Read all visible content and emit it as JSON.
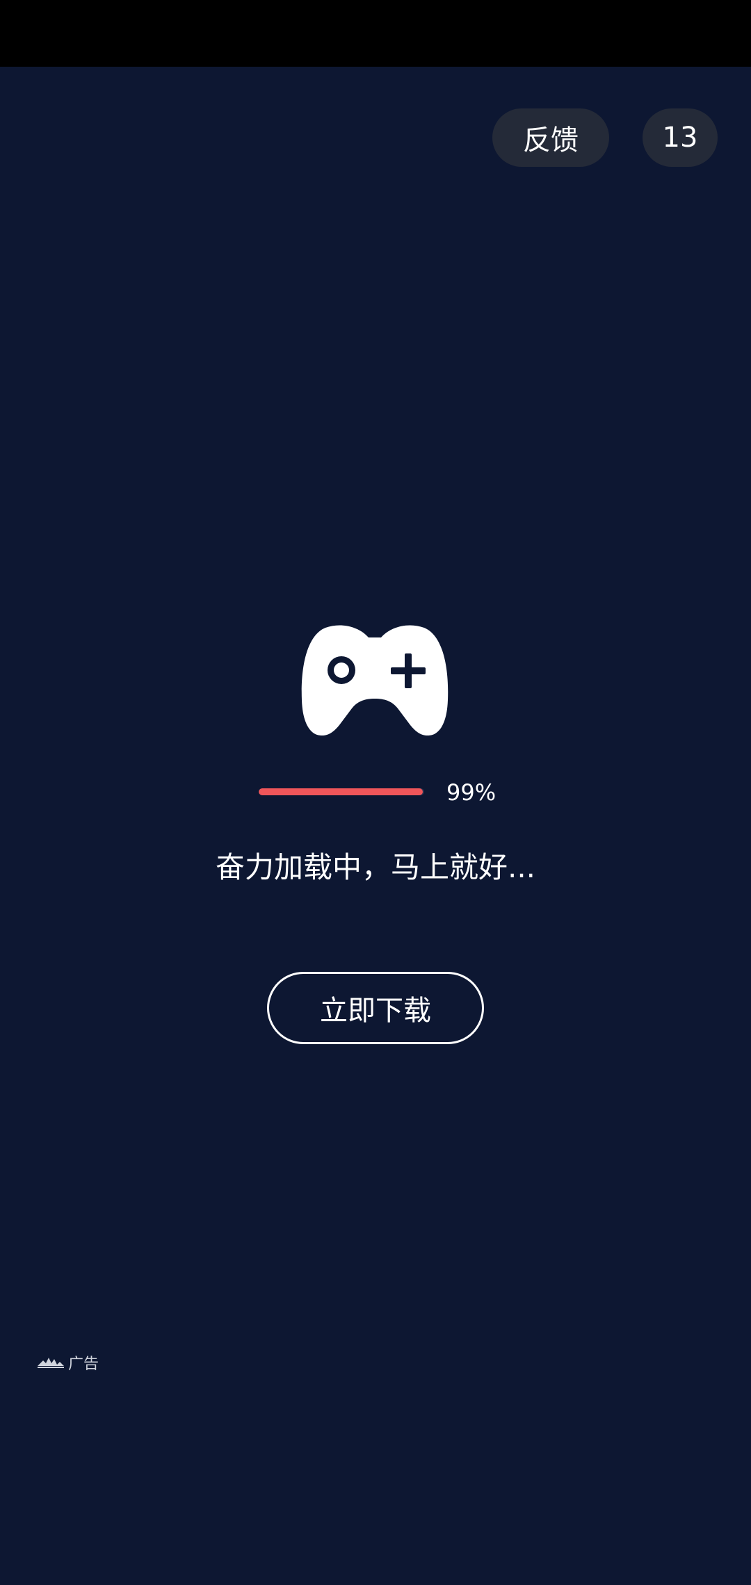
{
  "header": {
    "feedback_label": "反馈",
    "countdown": "13"
  },
  "loader": {
    "icon": "gamepad-icon",
    "progress_percent": 99,
    "progress_text": "99%",
    "message": "奋力加载中，马上就好..."
  },
  "actions": {
    "download_label": "立即下载"
  },
  "footer": {
    "ad_logo_icon": "ad-network-logo-icon",
    "ad_label": "广告"
  },
  "colors": {
    "background": "#0d1732",
    "progress": "#f0565a",
    "pill_bg": "#242a38"
  }
}
